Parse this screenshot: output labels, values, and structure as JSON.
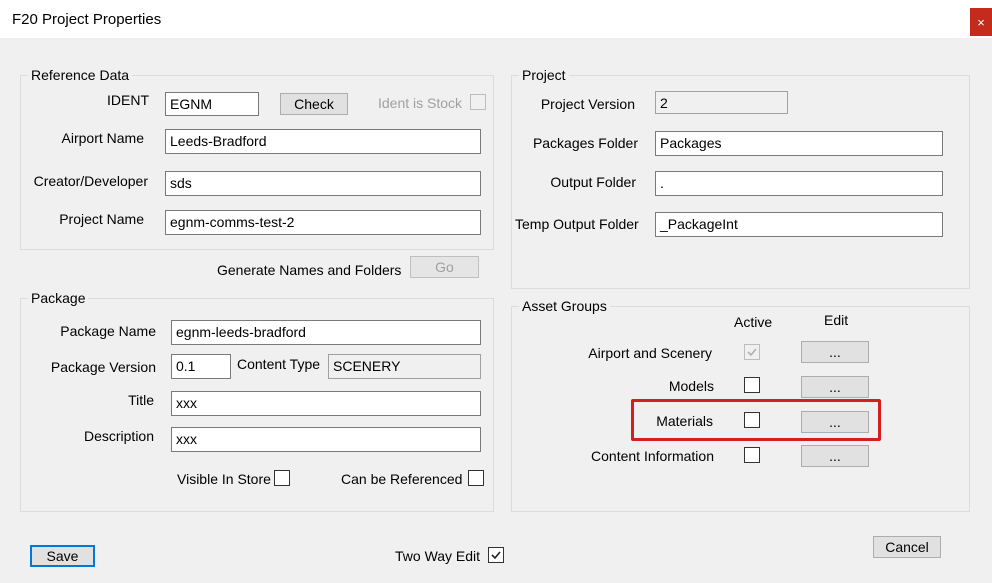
{
  "window": {
    "title": "F20 Project Properties",
    "close_glyph": "×"
  },
  "reference": {
    "legend": "Reference Data",
    "ident_label": "IDENT",
    "ident_value": "EGNM",
    "check_label": "Check",
    "stock_label": "Ident is Stock",
    "airport_label": "Airport Name",
    "airport_value": "Leeds-Bradford",
    "creator_label": "Creator/Developer",
    "creator_value": "sds",
    "project_label": "Project Name",
    "project_value": "egnm-comms-test-2"
  },
  "generate": {
    "label": "Generate Names and Folders",
    "go_label": "Go"
  },
  "package": {
    "legend": "Package",
    "name_label": "Package Name",
    "name_value": "egnm-leeds-bradford",
    "version_label": "Package Version",
    "version_value": "0.1",
    "content_type_label": "Content Type",
    "content_type_value": "SCENERY",
    "title_label": "Title",
    "title_value": "xxx",
    "description_label": "Description",
    "description_value": "xxx",
    "visible_label": "Visible In Store",
    "referenced_label": "Can be Referenced"
  },
  "project": {
    "legend": "Project",
    "version_label": "Project Version",
    "version_value": "2",
    "packages_label": "Packages Folder",
    "packages_value": "Packages",
    "output_label": "Output Folder",
    "output_value": ".",
    "temp_label": "Temp Output Folder",
    "temp_value": "_PackageInt"
  },
  "asset_groups": {
    "legend": "Asset Groups",
    "active_header": "Active",
    "edit_header": "Edit",
    "rows": [
      {
        "label": "Airport and Scenery",
        "active": true,
        "disabled": true,
        "edit_label": "..."
      },
      {
        "label": "Models",
        "active": false,
        "disabled": false,
        "edit_label": "..."
      },
      {
        "label": "Materials",
        "active": false,
        "disabled": false,
        "edit_label": "..."
      },
      {
        "label": "Content Information",
        "active": false,
        "disabled": false,
        "edit_label": "..."
      }
    ]
  },
  "footer": {
    "save_label": "Save",
    "two_way_label": "Two Way Edit",
    "two_way_checked": true,
    "cancel_label": "Cancel"
  },
  "colors": {
    "highlight": "#d21f1f",
    "default_button_border": "#0078d7",
    "close_bg": "#c42b1c"
  }
}
